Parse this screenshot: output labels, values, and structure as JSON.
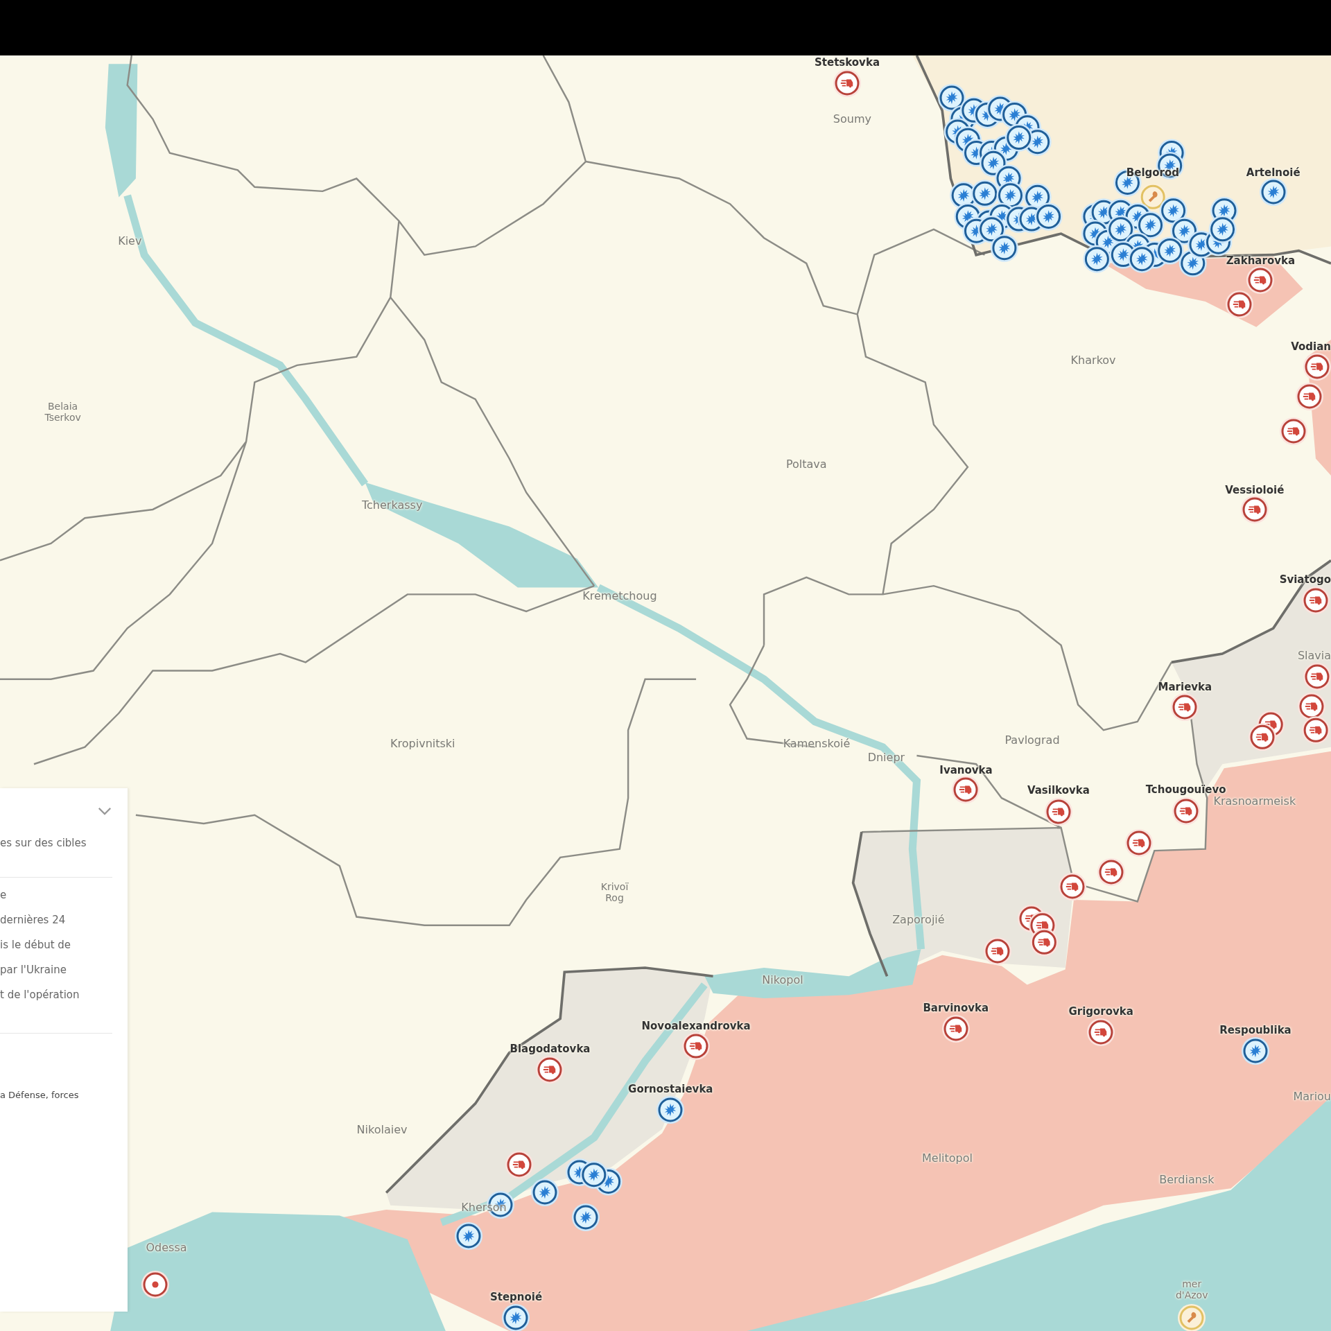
{
  "map": {
    "cities": [
      {
        "name": "Stetskovka",
        "kind": "place"
      },
      {
        "name": "Soumy",
        "kind": "town"
      },
      {
        "name": "Belgorod",
        "kind": "place"
      },
      {
        "name": "Artelnoié",
        "kind": "place"
      },
      {
        "name": "Kiev",
        "kind": "town"
      },
      {
        "name": "Zakharovka",
        "kind": "place"
      },
      {
        "name": "Vodian",
        "kind": "place"
      },
      {
        "name": "Kharkov",
        "kind": "town"
      },
      {
        "name": "Belaia Tserkov",
        "kind": "town"
      },
      {
        "name": "Poltava",
        "kind": "town"
      },
      {
        "name": "Vessioloié",
        "kind": "place"
      },
      {
        "name": "Tcherkassy",
        "kind": "town"
      },
      {
        "name": "Sviatogo",
        "kind": "place"
      },
      {
        "name": "Kremetchoug",
        "kind": "town"
      },
      {
        "name": "Slavia",
        "kind": "town"
      },
      {
        "name": "Marievka",
        "kind": "place"
      },
      {
        "name": "Kropivnitski",
        "kind": "town"
      },
      {
        "name": "Kamenskoié",
        "kind": "town"
      },
      {
        "name": "Pavlograd",
        "kind": "town"
      },
      {
        "name": "Dniepr",
        "kind": "town"
      },
      {
        "name": "Ivanovka",
        "kind": "place"
      },
      {
        "name": "Vasilkovka",
        "kind": "place"
      },
      {
        "name": "Tchougouïevo",
        "kind": "place"
      },
      {
        "name": "Krasnoarmeisk",
        "kind": "town"
      },
      {
        "name": "Krivoï Rog",
        "kind": "town"
      },
      {
        "name": "Zaporojié",
        "kind": "town"
      },
      {
        "name": "Nikopol",
        "kind": "town"
      },
      {
        "name": "Barvinovka",
        "kind": "place"
      },
      {
        "name": "Grigorovka",
        "kind": "place"
      },
      {
        "name": "Novoalexandrovka",
        "kind": "place"
      },
      {
        "name": "Respoublika",
        "kind": "place"
      },
      {
        "name": "Blagodatovka",
        "kind": "place"
      },
      {
        "name": "Gornostaievka",
        "kind": "place"
      },
      {
        "name": "Mariou",
        "kind": "town"
      },
      {
        "name": "Nikolaiev",
        "kind": "town"
      },
      {
        "name": "Melitopol",
        "kind": "town"
      },
      {
        "name": "Berdiansk",
        "kind": "town"
      },
      {
        "name": "Kherson",
        "kind": "town"
      },
      {
        "name": "Odessa",
        "kind": "town"
      },
      {
        "name": "Stepnoié",
        "kind": "place"
      },
      {
        "name": "mer d'Azov",
        "kind": "town"
      }
    ],
    "markers": [
      {
        "kind": "truck"
      },
      {
        "kind": "wrench"
      },
      {
        "kind": "burst"
      },
      {
        "kind": "truck"
      },
      {
        "kind": "truck"
      },
      {
        "kind": "truck"
      },
      {
        "kind": "truck"
      },
      {
        "kind": "truck"
      },
      {
        "kind": "truck"
      },
      {
        "kind": "truck"
      },
      {
        "kind": "truck"
      },
      {
        "kind": "truck"
      },
      {
        "kind": "truck"
      },
      {
        "kind": "truck"
      },
      {
        "kind": "truck"
      },
      {
        "kind": "truck"
      },
      {
        "kind": "truck"
      },
      {
        "kind": "truck"
      },
      {
        "kind": "truck"
      },
      {
        "kind": "truck"
      },
      {
        "kind": "truck"
      },
      {
        "kind": "truck"
      },
      {
        "kind": "truck"
      },
      {
        "kind": "truck"
      },
      {
        "kind": "truck"
      },
      {
        "kind": "truck"
      },
      {
        "kind": "truck"
      },
      {
        "kind": "truck"
      },
      {
        "kind": "burst"
      },
      {
        "kind": "truck"
      },
      {
        "kind": "truck"
      },
      {
        "kind": "burst"
      },
      {
        "kind": "truck"
      },
      {
        "kind": "dot"
      },
      {
        "kind": "burst"
      },
      {
        "kind": "wrench"
      },
      {
        "kind": "burst"
      },
      {
        "kind": "burst"
      },
      {
        "kind": "burst"
      },
      {
        "kind": "burst"
      },
      {
        "kind": "burst"
      },
      {
        "kind": "burst"
      },
      {
        "kind": "burst"
      },
      {
        "kind": "burst"
      },
      {
        "kind": "burst"
      },
      {
        "kind": "burst"
      },
      {
        "kind": "burst"
      },
      {
        "kind": "burst"
      },
      {
        "kind": "burst"
      },
      {
        "kind": "burst"
      },
      {
        "kind": "burst"
      },
      {
        "kind": "burst"
      },
      {
        "kind": "burst"
      },
      {
        "kind": "burst"
      },
      {
        "kind": "burst"
      },
      {
        "kind": "burst"
      },
      {
        "kind": "burst"
      },
      {
        "kind": "burst"
      },
      {
        "kind": "burst"
      },
      {
        "kind": "burst"
      },
      {
        "kind": "burst"
      },
      {
        "kind": "burst"
      },
      {
        "kind": "burst"
      },
      {
        "kind": "burst"
      },
      {
        "kind": "burst"
      },
      {
        "kind": "burst"
      },
      {
        "kind": "burst"
      },
      {
        "kind": "burst"
      },
      {
        "kind": "burst"
      },
      {
        "kind": "burst"
      },
      {
        "kind": "burst"
      },
      {
        "kind": "burst"
      },
      {
        "kind": "burst"
      },
      {
        "kind": "burst"
      },
      {
        "kind": "burst"
      },
      {
        "kind": "burst"
      },
      {
        "kind": "burst"
      },
      {
        "kind": "burst"
      },
      {
        "kind": "burst"
      },
      {
        "kind": "burst"
      },
      {
        "kind": "burst"
      },
      {
        "kind": "burst"
      },
      {
        "kind": "burst"
      },
      {
        "kind": "burst"
      },
      {
        "kind": "burst"
      },
      {
        "kind": "burst"
      },
      {
        "kind": "burst"
      },
      {
        "kind": "burst"
      },
      {
        "kind": "burst"
      },
      {
        "kind": "burst"
      },
      {
        "kind": "burst"
      },
      {
        "kind": "burst"
      },
      {
        "kind": "burst"
      },
      {
        "kind": "burst"
      },
      {
        "kind": "burst"
      },
      {
        "kind": "burst"
      }
    ]
  },
  "legend": {
    "sections": [
      {
        "lines": [
          "es sur des cibles"
        ]
      },
      {
        "lines": [
          "e",
          "dernières 24",
          "is le début de",
          "par l'Ukraine",
          "t de l'opération"
        ]
      },
      {
        "lines": [
          "a Défense, forces"
        ]
      }
    ]
  }
}
